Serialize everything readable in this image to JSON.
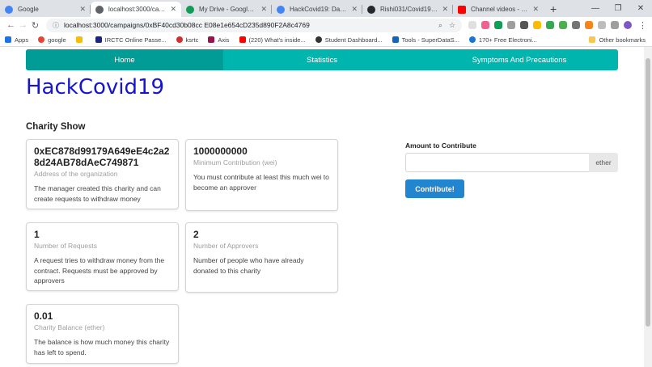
{
  "browser": {
    "tabs": [
      {
        "label": "Google",
        "color": "#4285f4"
      },
      {
        "label": "localhost:3000/campaigns",
        "color": "#5f6368"
      },
      {
        "label": "My Drive - Google Drive",
        "color": "#0f9d58"
      },
      {
        "label": "HackCovid19: Dashboard",
        "color": "#4285f4"
      },
      {
        "label": "Rishi031/Covid19-charity",
        "color": "#24292e"
      },
      {
        "label": "Channel videos - YouTube",
        "color": "#ff0000"
      }
    ],
    "new_tab_label": "+",
    "url": "localhost:3000/campaigns/0xBF40cd30b08cc E08e1e654cD235d890F2A8c4769",
    "bookmarks": [
      {
        "label": "Apps",
        "color": "#1a73e8"
      },
      {
        "label": "google",
        "color": "#ea4335"
      },
      {
        "label": "",
        "color": "#fbbc04"
      },
      {
        "label": "IRCTC Online Passe...",
        "color": "#1a237e"
      },
      {
        "label": "ksrtc",
        "color": "#d32f2f"
      },
      {
        "label": "Axis",
        "color": "#97144d"
      },
      {
        "label": "(220) What's inside...",
        "color": "#ff0000"
      },
      {
        "label": "Student Dashboard...",
        "color": "#333333"
      },
      {
        "label": "Tools - SuperDataS...",
        "color": "#1565c0"
      },
      {
        "label": "170+ Free Electroni...",
        "color": "#1976d2"
      }
    ],
    "other_bookmarks": "Other bookmarks"
  },
  "nav": {
    "items": [
      "Home",
      "Statistics",
      "Symptoms And Precautions"
    ],
    "active_color": "#009c95",
    "menu_color": "#00b5ad"
  },
  "brand": "HackCovid19",
  "section_title": "Charity Show",
  "cards": [
    {
      "header": "0xEC878d99179A649eE4c2a28d24AB78dAeC749871",
      "meta": "Address of the organization",
      "description": "The manager created this charity and can create requests to withdraw money"
    },
    {
      "header": "1000000000",
      "meta": "Minimum Contribution (wei)",
      "description": "You must contribute at least this much wei to become an approver"
    },
    {
      "header": "1",
      "meta": "Number of Requests",
      "description": "A request tries to withdraw money from the contract. Requests must be approved by approvers"
    },
    {
      "header": "2",
      "meta": "Number of Approvers",
      "description": "Number of people who have already donated to this charity"
    },
    {
      "header": "0.01",
      "meta": "Charity Balance (ether)",
      "description": "The balance is how much money this charity has left to spend."
    }
  ],
  "contribute": {
    "label": "Amount to Contribute",
    "input_value": "",
    "unit": "ether",
    "button": "Contribute!",
    "button_color": "#2185d0"
  }
}
